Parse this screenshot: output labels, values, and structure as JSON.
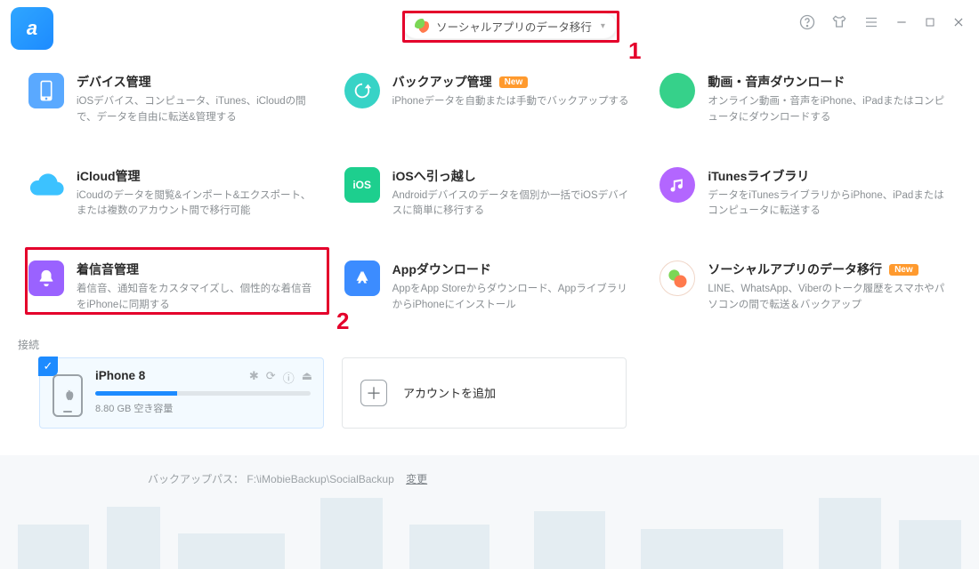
{
  "titlebar": {
    "logo_text": "a",
    "dropdown_label": "ソーシャルアプリのデータ移行"
  },
  "annotations": {
    "n1": "1",
    "n2": "2"
  },
  "cards": {
    "device": {
      "title": "デバイス管理",
      "desc": "iOSデバイス、コンピュータ、iTunes、iCloudの間で、データを自由に転送&管理する"
    },
    "backup": {
      "title": "バックアップ管理",
      "desc": "iPhoneデータを自動または手動でバックアップする",
      "badge": "New"
    },
    "download": {
      "title": "動画・音声ダウンロード",
      "desc": "オンライン動画・音声をiPhone、iPadまたはコンピュータにダウンロードする"
    },
    "icloud": {
      "title": "iCloud管理",
      "desc": "iCoudのデータを閲覧&インポート&エクスポート、または複数のアカウント間で移行可能"
    },
    "ios": {
      "title": "iOSへ引っ越し",
      "desc": "Androidデバイスのデータを個別か一括でiOSデバイスに簡単に移行する"
    },
    "itunes": {
      "title": "iTunesライブラリ",
      "desc": "データをiTunesライブラリからiPhone、iPadまたはコンピュータに転送する"
    },
    "ringtone": {
      "title": "着信音管理",
      "desc": "着信音、通知音をカスタマイズし、個性的な着信音をiPhoneに同期する"
    },
    "app": {
      "title": "Appダウンロード",
      "desc": "AppをApp Storeからダウンロード、AppライブラリからiPhoneにインストール"
    },
    "social": {
      "title": "ソーシャルアプリのデータ移行",
      "desc": "LINE、WhatsApp、Viberのトーク履歴をスマホやパソコンの間で転送＆バックアップ",
      "badge": "New"
    }
  },
  "connection": {
    "label": "接続",
    "device_name": "iPhone 8",
    "storage_text": "8.80 GB 空き容量",
    "add_account": "アカウントを追加"
  },
  "ghost": {
    "backup_path_label": "バックアップパス：",
    "backup_path_value": "F:\\iMobieBackup\\SocialBackup",
    "change": "変更"
  }
}
